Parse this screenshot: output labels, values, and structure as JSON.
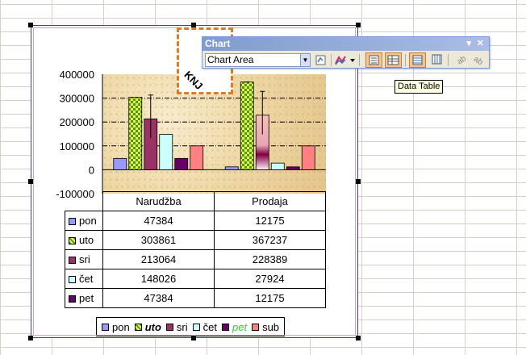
{
  "toolbar": {
    "title": "Chart",
    "dropdown_icon": "chevron-down-icon",
    "close_label": "✕",
    "menu_label": "▾",
    "chart_objects_value": "Chart Area",
    "format_icon": "format-chart-area-icon",
    "chart_type_icon": "chart-type-icon",
    "legend_icon": "legend-icon",
    "data_table_icon": "data-table-icon",
    "by_row_icon": "by-row-icon",
    "by_column_icon": "by-column-icon",
    "angle_clockwise_icon": "angle-text-downward-icon",
    "angle_counter_icon": "angle-text-upward-icon"
  },
  "tooltip": "Data Table",
  "selected_text": "KNJ",
  "colors": {
    "pon": "#9999ff",
    "uto": "#ccff66",
    "sri": "#993366",
    "cet": "#ccffff",
    "pet": "#660066",
    "sub": "#ff8080",
    "selection": "#e07a1f"
  },
  "chart_data": {
    "type": "bar",
    "categories": [
      "Narudžba",
      "Prodaja"
    ],
    "series": [
      {
        "name": "pon",
        "values": [
          47384,
          12175
        ]
      },
      {
        "name": "uto",
        "values": [
          303861,
          367237
        ]
      },
      {
        "name": "sri",
        "values": [
          213064,
          228389
        ]
      },
      {
        "name": "čet",
        "values": [
          148026,
          27924
        ]
      },
      {
        "name": "pet",
        "values": [
          47384,
          12175
        ]
      },
      {
        "name": "sub",
        "values": [
          100000,
          100000
        ]
      }
    ],
    "error_bars": {
      "uto": [
        null,
        0
      ],
      "sri": [
        100000,
        100000
      ]
    },
    "ylim": [
      -100000,
      400000
    ],
    "yticks": [
      "400000",
      "300000",
      "200000",
      "100000",
      "0",
      "-100000"
    ],
    "gridlines": "dash-dot",
    "legend_position": "bottom",
    "data_table": true
  },
  "table_rows": [
    {
      "label": "pon",
      "v1": "47384",
      "v2": "12175"
    },
    {
      "label": "uto",
      "v1": "303861",
      "v2": "367237"
    },
    {
      "label": "sri",
      "v1": "213064",
      "v2": "228389"
    },
    {
      "label": "čet",
      "v1": "148026",
      "v2": "27924"
    },
    {
      "label": "pet",
      "v1": "47384",
      "v2": "12175"
    }
  ],
  "table_header": [
    "Narudžba",
    "Prodaja"
  ],
  "legend": [
    "pon",
    "uto",
    "sri",
    "čet",
    "pet",
    "sub"
  ]
}
